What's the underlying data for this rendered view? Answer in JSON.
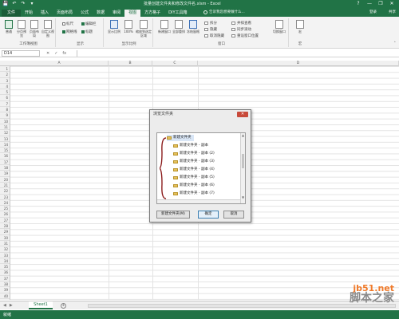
{
  "window": {
    "title": "批量创建文件夹和修改文件名.xlsm - Excel",
    "controls": [
      "?",
      "—",
      "❐",
      "✕"
    ]
  },
  "qat": [
    "💾",
    "↶",
    "↷",
    "▾"
  ],
  "tabs": [
    "文件",
    "开始",
    "插入",
    "页面布局",
    "公式",
    "数据",
    "审阅",
    "视图",
    "方方格子",
    "DIY工具箱"
  ],
  "active_tab": "视图",
  "tellme": "告诉我您想要做什么...",
  "login": "登录",
  "share": "共享",
  "ribbon": {
    "views": {
      "label": "工作簿视图",
      "buttons": [
        "普通",
        "分页预览",
        "页面布局",
        "自定义视图"
      ]
    },
    "show": {
      "label": "显示",
      "checks": [
        {
          "text": "标尺",
          "on": false
        },
        {
          "text": "编辑栏",
          "on": true
        },
        {
          "text": "网格线",
          "on": true
        },
        {
          "text": "标题",
          "on": true
        }
      ]
    },
    "zoom": {
      "label": "显示比例",
      "buttons": [
        "显示比例",
        "100%",
        "缩放到选定区域"
      ]
    },
    "window": {
      "label": "窗口",
      "buttons": [
        "新建窗口",
        "全部重排",
        "冻结窗格"
      ],
      "small": [
        "拆分",
        "隐藏",
        "取消隐藏",
        "并排查看",
        "同步滚动",
        "重设窗口位置"
      ],
      "switch": "切换窗口"
    },
    "macro": {
      "label": "宏",
      "button": "宏"
    }
  },
  "formula_bar": {
    "name_box": "D14",
    "fx_symbols": [
      "✕",
      "✓",
      "fx"
    ],
    "value": ""
  },
  "columns": [
    "A",
    "B",
    "C",
    "D"
  ],
  "rows": [
    "1",
    "2",
    "3",
    "4",
    "5",
    "6",
    "7",
    "8",
    "9",
    "10",
    "11",
    "12",
    "13",
    "14",
    "15",
    "16",
    "17",
    "18",
    "19",
    "20",
    "21",
    "22",
    "23",
    "24",
    "25",
    "26",
    "27",
    "28",
    "29",
    "30",
    "31",
    "32",
    "33",
    "34",
    "35",
    "36",
    "37",
    "38",
    "39",
    "40"
  ],
  "sheet": {
    "tab": "Sheet1",
    "add": "+",
    "nav": [
      "◀",
      "▶"
    ]
  },
  "status": "就绪",
  "dialog": {
    "title": "浏览文件夹",
    "close": "✕",
    "root": "新建文件夹",
    "items": [
      "新建文件夹",
      "新建文件夹 - 副本",
      "新建文件夹 - 副本 (2)",
      "新建文件夹 - 副本 (3)",
      "新建文件夹 - 副本 (4)",
      "新建文件夹 - 副本 (5)",
      "新建文件夹 - 副本 (6)",
      "新建文件夹 - 副本 (7)"
    ],
    "buttons": {
      "new_folder": "新建文件夹(M)",
      "ok": "确定",
      "cancel": "取消"
    }
  },
  "watermark": {
    "domain": "jb51.net",
    "name": "脚本之家"
  }
}
